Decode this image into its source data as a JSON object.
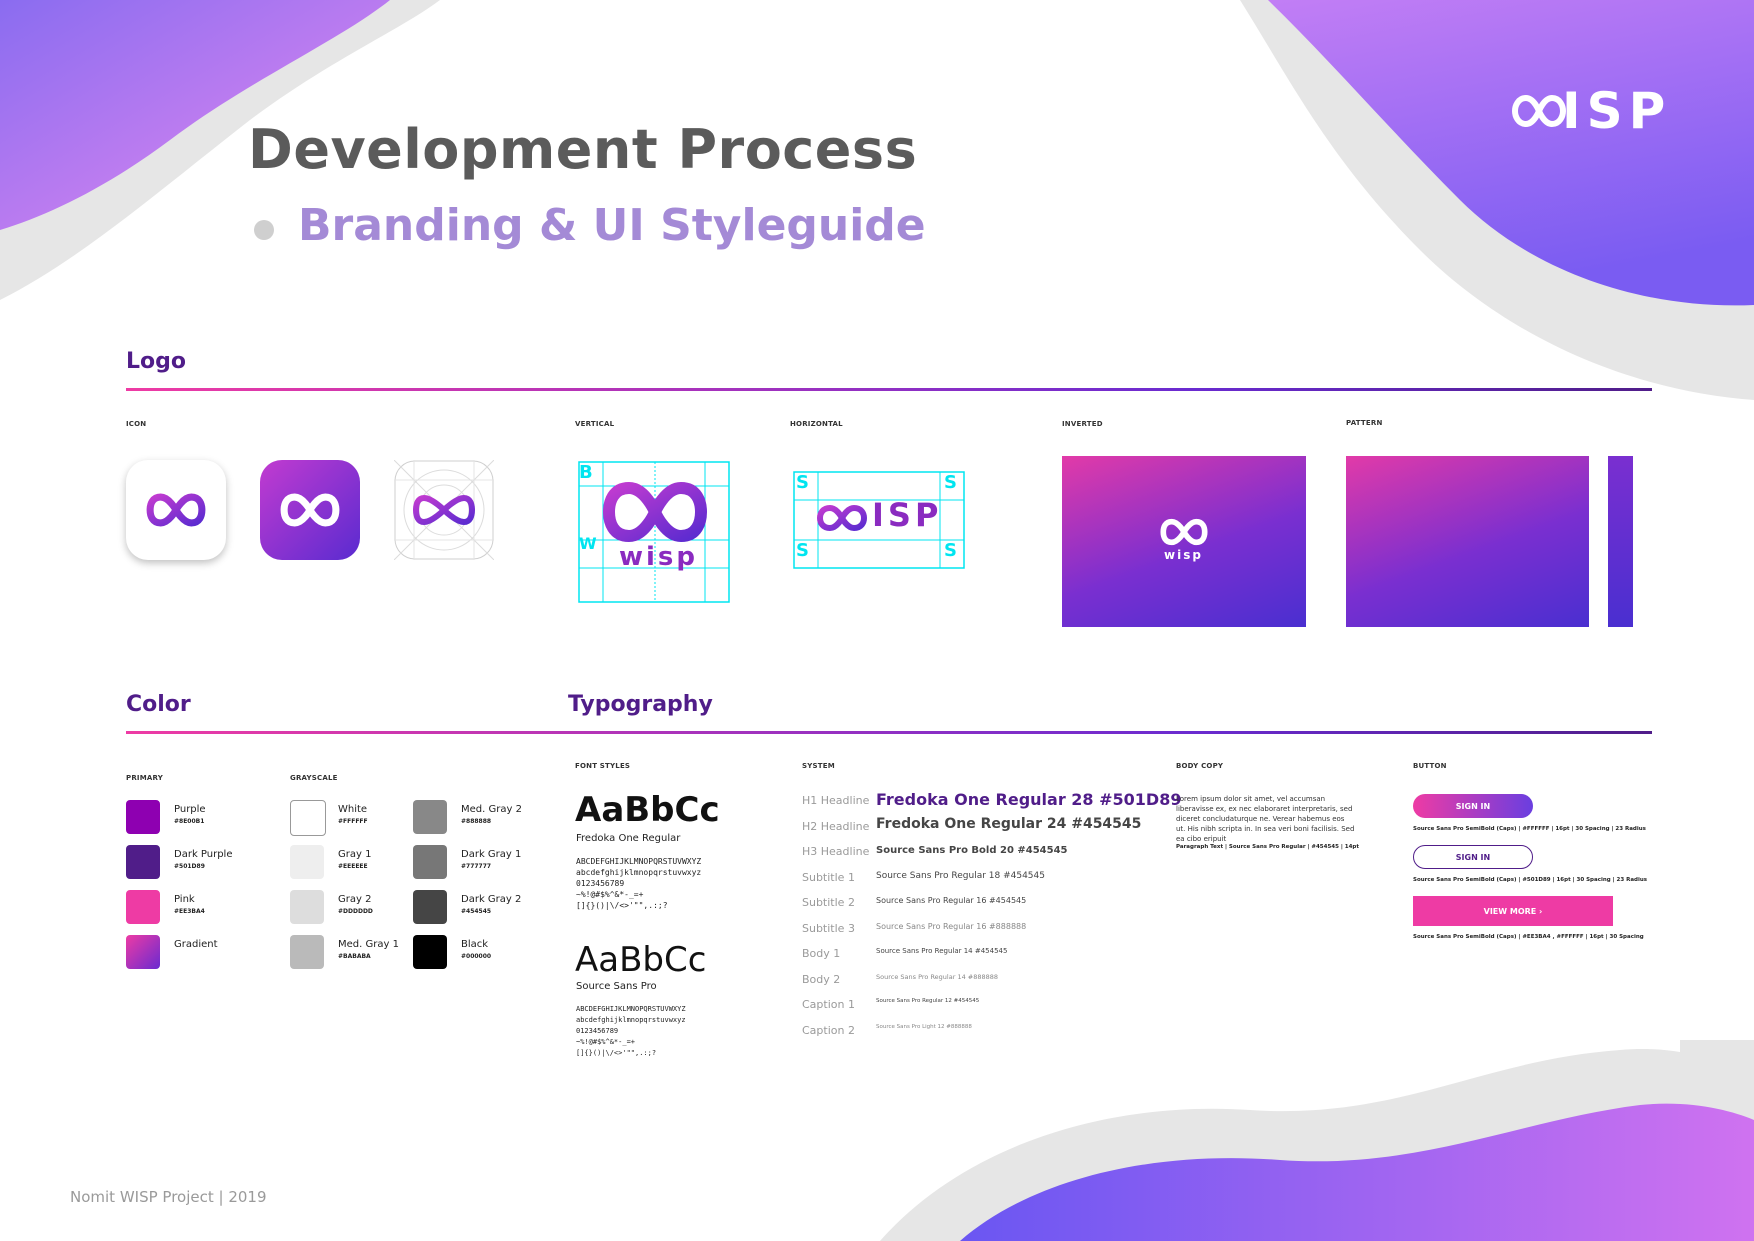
{
  "header": {
    "title": "Development Process",
    "subtitle": "Branding & UI Styleguide",
    "brand_text": "ISP"
  },
  "logo_section": {
    "title": "Logo",
    "labels": {
      "icon": "ICON",
      "vertical": "VERTICAL",
      "horizontal": "HORIZONTAL",
      "inverted": "INVERTED",
      "pattern": "PATTERN"
    },
    "wordmark": "wisp",
    "guide_letters": {
      "b": "B",
      "w": "W",
      "s": "S"
    }
  },
  "color_section": {
    "title": "Color",
    "primary_label": "PRIMARY",
    "grayscale_label": "GRAYSCALE",
    "primary": [
      {
        "name": "Purple",
        "hex": "#8E00B1",
        "color": "#8e00b1"
      },
      {
        "name": "Dark Purple",
        "hex": "#501D89",
        "color": "#501d89"
      },
      {
        "name": "Pink",
        "hex": "#EE3BA4",
        "color": "#ee3ba4"
      },
      {
        "name": "Gradient",
        "hex": "",
        "color": "linear-gradient(135deg,#ee3ba4,#6a2bd0)"
      }
    ],
    "grayscale_left": [
      {
        "name": "White",
        "hex": "#FFFFFF",
        "color": "#ffffff"
      },
      {
        "name": "Gray 1",
        "hex": "#EEEEEE",
        "color": "#eeeeee"
      },
      {
        "name": "Gray 2",
        "hex": "#DDDDDD",
        "color": "#dddddd"
      },
      {
        "name": "Med. Gray 1",
        "hex": "#BABABA",
        "color": "#bababa"
      }
    ],
    "grayscale_right": [
      {
        "name": "Med. Gray 2",
        "hex": "#888888",
        "color": "#888888"
      },
      {
        "name": "Dark Gray 1",
        "hex": "#777777",
        "color": "#777777"
      },
      {
        "name": "Dark Gray 2",
        "hex": "#454545",
        "color": "#454545"
      },
      {
        "name": "Black",
        "hex": "#000000",
        "color": "#000000"
      }
    ]
  },
  "typography_section": {
    "title": "Typography",
    "font_styles_label": "FONT STYLES",
    "system_label": "SYSTEM",
    "body_copy_label": "BODY COPY",
    "button_label": "BUTTON",
    "fonts": [
      {
        "sample": "AaBbCc",
        "name": "Fredoka One Regular",
        "glyphs": "ABCDEFGHIJKLMNOPQRSTUVWXYZ\nabcdefghijklmnopqrstuvwxyz\n0123456789\n~%!@#$%^&*-_=+\n[]{}()|\\/<>'\"\",.:;?"
      },
      {
        "sample": "AaBbCc",
        "name": "Source Sans Pro",
        "glyphs": "ABCDEFGHIJKLMNOPQRSTUVWXYZ\nabcdefghijklmnopqrstuvwxyz\n0123456789\n~%!@#$%^&*-_=+\n[]{}()|\\/<>'\"\",.:;?"
      }
    ],
    "system": [
      {
        "label": "H1 Headline",
        "sample": "Fredoka One Regular 28 #501D89"
      },
      {
        "label": "H2 Headline",
        "sample": "Fredoka One Regular 24 #454545"
      },
      {
        "label": "H3 Headline",
        "sample": "Source Sans Pro Bold 20 #454545"
      },
      {
        "label": "Subtitle 1",
        "sample": "Source Sans Pro Regular 18 #454545"
      },
      {
        "label": "Subtitle 2",
        "sample": "Source Sans Pro Regular 16 #454545"
      },
      {
        "label": "Subtitle 3",
        "sample": "Source Sans Pro Regular 16 #888888"
      },
      {
        "label": "Body 1",
        "sample": "Source Sans Pro Regular 14 #454545"
      },
      {
        "label": "Body 2",
        "sample": "Source Sans Pro Regular 14 #888888"
      },
      {
        "label": "Caption 1",
        "sample": "Source Sans Pro Regular 12 #454545"
      },
      {
        "label": "Caption 2",
        "sample": "Source Sans Pro Light 12 #888888"
      }
    ],
    "body_copy": {
      "text": "Lorem ipsum dolor sit amet, vel accumsan liberavisse ex, ex nec elaboraret interpretaris, sed diceret concludaturque ne. Verear habemus eos ut. His nibh scripta in. In sea veri boni facilisis. Sed ea cibo eripuit",
      "note": "Paragraph Text | Source Sans Pro Regular | #454545 | 14pt"
    },
    "buttons": [
      {
        "label": "SIGN IN",
        "note": "Source Sans Pro SemiBold (Caps) | #FFFFFF | 16pt | 30 Spacing | 23 Radius"
      },
      {
        "label": "SIGN IN",
        "note": "Source Sans Pro SemiBold (Caps) | #501D89 | 16pt | 30 Spacing | 23 Radius"
      },
      {
        "label": "VIEW MORE ›",
        "note": "Source Sans Pro SemiBold (Caps) | #EE3BA4 , #FFFFFF | 16pt | 30 Spacing"
      }
    ]
  },
  "footer": {
    "text": "Nomit WISP Project  |  2019"
  },
  "colors": {
    "dark_purple": "#501d89",
    "pink": "#ee3ba4",
    "violet": "#6a2bd0",
    "guide_cyan": "#00e5f0"
  }
}
